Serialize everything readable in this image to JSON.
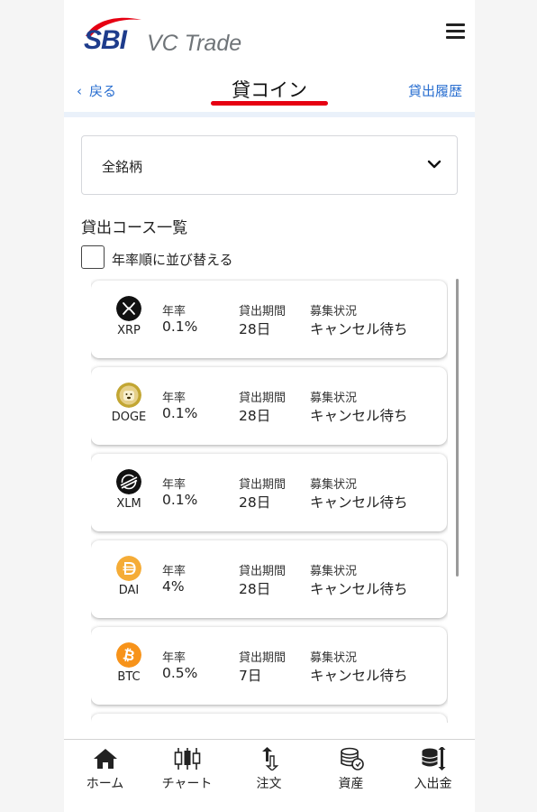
{
  "header": {
    "logo_sbi": "SBI",
    "logo_product": "VC Trade",
    "menu_icon": "hamburger-menu-icon"
  },
  "subnav": {
    "back_label": "戻る",
    "title": "貸コイン",
    "history_label": "貸出履歴"
  },
  "filter": {
    "selected": "全銘柄"
  },
  "section": {
    "title": "貸出コース一覧",
    "sort_label": "年率順に並び替える",
    "sort_checked": false
  },
  "labels": {
    "rate": "年率",
    "period": "貸出期間",
    "status": "募集状況"
  },
  "courses": [
    {
      "symbol": "XRP",
      "rate": "0.1%",
      "period": "28日",
      "status": "キャンセル待ち",
      "icon": "xrp-icon",
      "color": "#111111"
    },
    {
      "symbol": "DOGE",
      "rate": "0.1%",
      "period": "28日",
      "status": "キャンセル待ち",
      "icon": "doge-icon",
      "color": "#c2a633"
    },
    {
      "symbol": "XLM",
      "rate": "0.1%",
      "period": "28日",
      "status": "キャンセル待ち",
      "icon": "xlm-icon",
      "color": "#111111"
    },
    {
      "symbol": "DAI",
      "rate": "4%",
      "period": "28日",
      "status": "キャンセル待ち",
      "icon": "dai-icon",
      "color": "#f5ac37"
    },
    {
      "symbol": "BTC",
      "rate": "0.5%",
      "period": "7日",
      "status": "キャンセル待ち",
      "icon": "btc-icon",
      "color": "#f7931a"
    }
  ],
  "tabbar": [
    {
      "label": "ホーム",
      "icon": "home-icon"
    },
    {
      "label": "チャート",
      "icon": "candlestick-chart-icon"
    },
    {
      "label": "注文",
      "icon": "order-arrows-icon"
    },
    {
      "label": "資産",
      "icon": "coin-stack-icon"
    },
    {
      "label": "入出金",
      "icon": "deposit-withdraw-icon"
    }
  ],
  "colors": {
    "brand_blue": "#1e3c8c",
    "brand_red": "#e60012",
    "link_blue": "#2a6fd0"
  }
}
